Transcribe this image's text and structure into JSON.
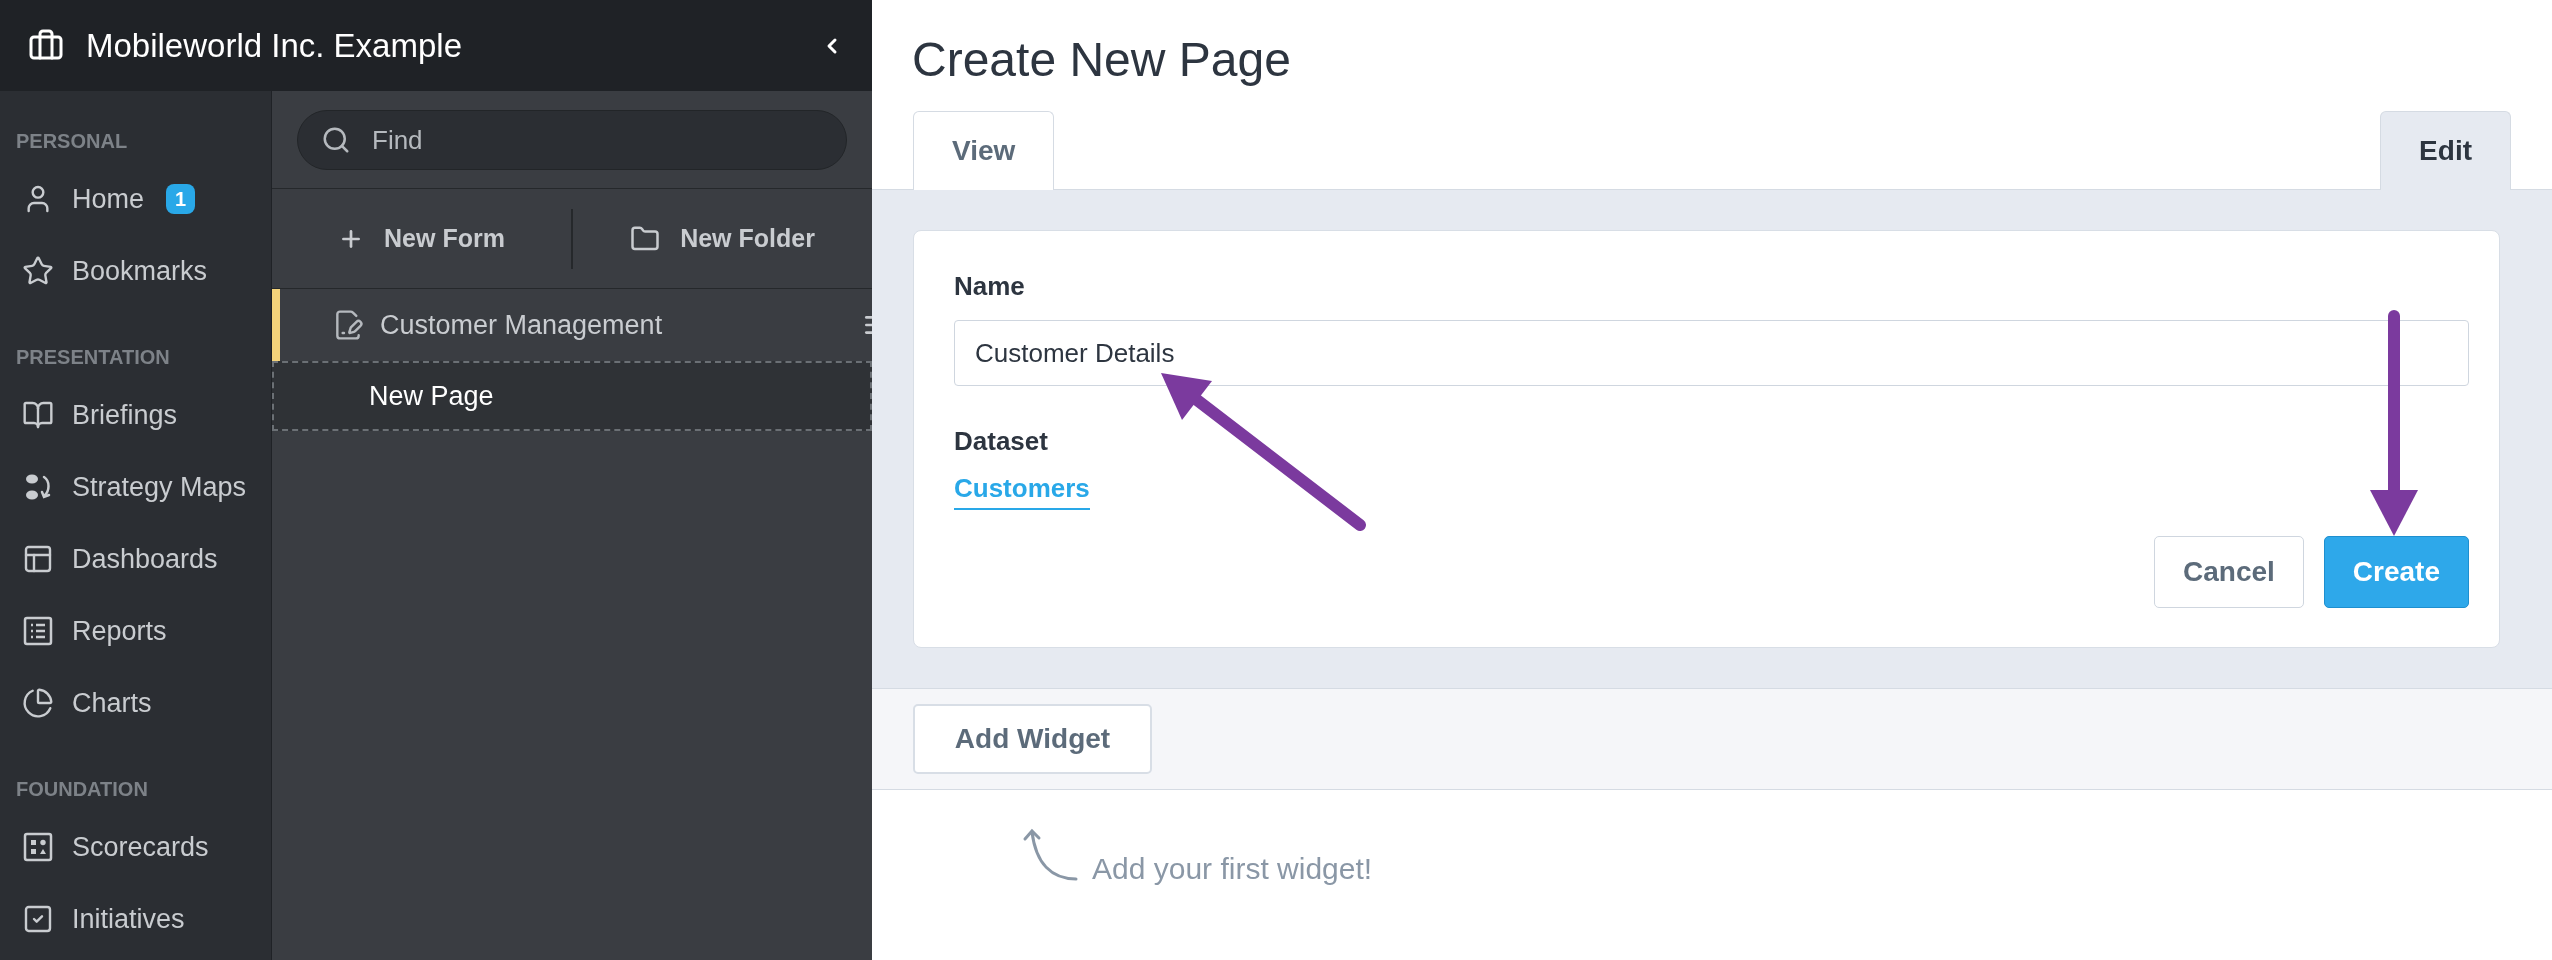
{
  "header": {
    "title": "Mobileworld Inc. Example"
  },
  "nav": {
    "sections": [
      {
        "heading": "PERSONAL",
        "items": [
          {
            "label": "Home",
            "badge": "1"
          },
          {
            "label": "Bookmarks"
          }
        ]
      },
      {
        "heading": "PRESENTATION",
        "items": [
          {
            "label": "Briefings"
          },
          {
            "label": "Strategy Maps"
          },
          {
            "label": "Dashboards"
          },
          {
            "label": "Reports"
          },
          {
            "label": "Charts"
          }
        ]
      },
      {
        "heading": "FOUNDATION",
        "items": [
          {
            "label": "Scorecards"
          },
          {
            "label": "Initiatives"
          }
        ]
      }
    ]
  },
  "finder": {
    "search": {
      "placeholder": "Find"
    },
    "actions": [
      "New Form",
      "New Folder"
    ],
    "items": [
      {
        "label": "Customer Management",
        "kind": "form",
        "selected": true
      },
      {
        "label": "New Page",
        "kind": "draft",
        "selected": false
      }
    ]
  },
  "page": {
    "title": "Create New Page",
    "tabs": [
      {
        "label": "View",
        "selected": false
      },
      {
        "label": "Edit",
        "selected": true
      }
    ],
    "form": {
      "name_label": "Name",
      "name_value": "Customer Details",
      "dataset_label": "Dataset",
      "dataset_link": "Customers",
      "buttons": [
        {
          "label": "Cancel",
          "kind": "secondary"
        },
        {
          "label": "Create",
          "kind": "primary"
        }
      ]
    },
    "add_widget": "Add Widget",
    "hint": "Add your first widget!"
  }
}
